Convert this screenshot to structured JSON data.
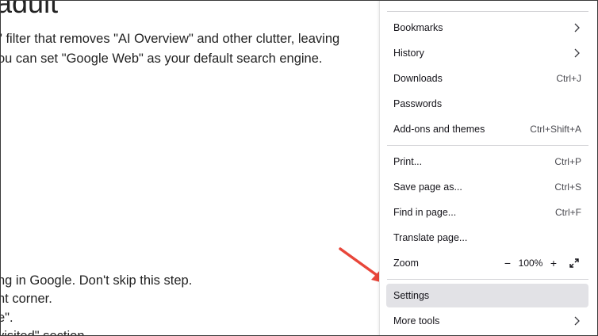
{
  "article": {
    "heading": "adult",
    "lines": [
      "\" filter that removes \"AI Overview\" and other clutter, leaving",
      "ou can set \"Google Web\" as your default search engine.",
      "ng in Google. Don't skip this step.",
      "nt corner.",
      "e\".",
      "visited\" section."
    ]
  },
  "menu": {
    "items": [
      {
        "label": "Bookmarks",
        "shortcut": "",
        "submenu": true
      },
      {
        "label": "History",
        "shortcut": "",
        "submenu": true
      },
      {
        "label": "Downloads",
        "shortcut": "Ctrl+J",
        "submenu": false
      },
      {
        "label": "Passwords",
        "shortcut": "",
        "submenu": false
      },
      {
        "label": "Add-ons and themes",
        "shortcut": "Ctrl+Shift+A",
        "submenu": false
      },
      {
        "label": "Print...",
        "shortcut": "Ctrl+P",
        "submenu": false
      },
      {
        "label": "Save page as...",
        "shortcut": "Ctrl+S",
        "submenu": false
      },
      {
        "label": "Find in page...",
        "shortcut": "Ctrl+F",
        "submenu": false
      },
      {
        "label": "Translate page...",
        "shortcut": "",
        "submenu": false
      },
      {
        "label": "Settings",
        "shortcut": "",
        "submenu": false
      },
      {
        "label": "More tools",
        "shortcut": "",
        "submenu": true
      }
    ],
    "zoom": {
      "label": "Zoom",
      "minus": "−",
      "value": "100%",
      "plus": "+",
      "fullscreen_icon": "fullscreen-icon"
    },
    "highlighted": "Settings"
  },
  "annotation": {
    "arrow_color": "#e8463a"
  }
}
